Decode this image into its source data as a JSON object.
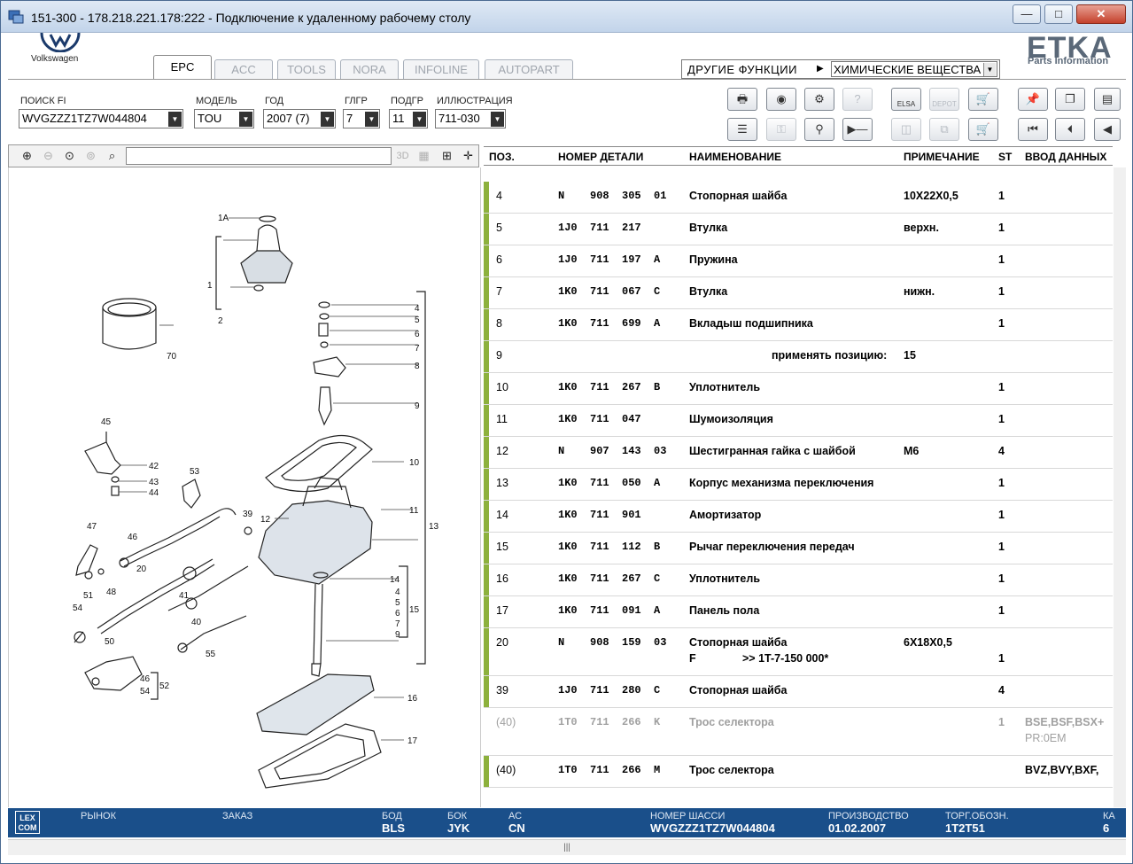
{
  "window": {
    "title": "151-300 - 178.218.221.178:222 - Подключение к удаленному рабочему столу",
    "min": "—",
    "max": "□",
    "close": "✕"
  },
  "brand": {
    "vw": "Volkswagen",
    "etka": "ETKA",
    "etka_sub": "Parts Information"
  },
  "tabs": [
    {
      "label": "EPC"
    },
    {
      "label": "ACC"
    },
    {
      "label": "TOOLS"
    },
    {
      "label": "NORA"
    },
    {
      "label": "INFOLINE"
    },
    {
      "label": "AUTOPART"
    }
  ],
  "other_functions": {
    "label": "ДРУГИЕ ФУНКЦИИ",
    "value": "ХИМИЧЕСКИЕ ВЕЩЕСТВА"
  },
  "filters": {
    "search_fi": {
      "label": "ПОИСК FI",
      "value": "WVGZZZ1TZ7W044804"
    },
    "model": {
      "label": "МОДЕЛЬ",
      "value": "TOU"
    },
    "year": {
      "label": "ГОД",
      "value": "2007 (7)"
    },
    "main_group": {
      "label": "ГЛГР",
      "value": "7"
    },
    "sub_group": {
      "label": "ПОДГР",
      "value": "11"
    },
    "illustration": {
      "label": "ИЛЛЮСТРАЦИЯ",
      "value": "711-030"
    }
  },
  "toolbar": {
    "elsa": "ELSA",
    "depot": "DEPOT"
  },
  "grid": {
    "headers": {
      "pos": "ПОЗ.",
      "part_no": "НОМЕР ДЕТАЛИ",
      "name": "НАИМЕНОВАНИЕ",
      "note": "ПРИМЕЧАНИЕ",
      "st": "ST",
      "data": "ВВОД ДАННЫХ"
    },
    "rows": [
      {
        "pos": "4",
        "p1": "N",
        "p2": "908",
        "p3": "305",
        "p4": "01",
        "name": "Стопорная шайба",
        "note": "10X22X0,5",
        "st": "1",
        "data": ""
      },
      {
        "pos": "5",
        "p1": "1J0",
        "p2": "711",
        "p3": "217",
        "p4": "",
        "name": "Втулка",
        "note": "верхн.",
        "st": "1",
        "data": ""
      },
      {
        "pos": "6",
        "p1": "1J0",
        "p2": "711",
        "p3": "197",
        "p4": "A",
        "name": "Пружина",
        "note": "",
        "st": "1",
        "data": ""
      },
      {
        "pos": "7",
        "p1": "1K0",
        "p2": "711",
        "p3": "067",
        "p4": "C",
        "name": "Втулка",
        "note": "нижн.",
        "st": "1",
        "data": ""
      },
      {
        "pos": "8",
        "p1": "1K0",
        "p2": "711",
        "p3": "699",
        "p4": "A",
        "name": "Вкладыш подшипника",
        "note": "",
        "st": "1",
        "data": ""
      },
      {
        "pos": "9",
        "p1": "",
        "p2": "",
        "p3": "",
        "p4": "",
        "name": "применять позицию:",
        "note": "15",
        "st": "",
        "data": ""
      },
      {
        "pos": "10",
        "p1": "1K0",
        "p2": "711",
        "p3": "267",
        "p4": "B",
        "name": "Уплотнитель",
        "note": "",
        "st": "1",
        "data": ""
      },
      {
        "pos": "11",
        "p1": "1K0",
        "p2": "711",
        "p3": "047",
        "p4": "",
        "name": "Шумоизоляция",
        "note": "",
        "st": "1",
        "data": ""
      },
      {
        "pos": "12",
        "p1": "N",
        "p2": "907",
        "p3": "143",
        "p4": "03",
        "name": "Шестигранная гайка с шайбой",
        "note": "M6",
        "st": "4",
        "data": ""
      },
      {
        "pos": "13",
        "p1": "1K0",
        "p2": "711",
        "p3": "050",
        "p4": "A",
        "name": "Корпус механизма переключения",
        "note": "",
        "st": "1",
        "data": ""
      },
      {
        "pos": "14",
        "p1": "1K0",
        "p2": "711",
        "p3": "901",
        "p4": "",
        "name": "Амортизатор",
        "note": "",
        "st": "1",
        "data": ""
      },
      {
        "pos": "15",
        "p1": "1K0",
        "p2": "711",
        "p3": "112",
        "p4": "B",
        "name": "Рычаг переключения передач",
        "note": "",
        "st": "1",
        "data": ""
      },
      {
        "pos": "16",
        "p1": "1K0",
        "p2": "711",
        "p3": "267",
        "p4": "C",
        "name": "Уплотнитель",
        "note": "",
        "st": "1",
        "data": ""
      },
      {
        "pos": "17",
        "p1": "1K0",
        "p2": "711",
        "p3": "091",
        "p4": "A",
        "name": "Панель пола",
        "note": "",
        "st": "1",
        "data": ""
      },
      {
        "pos": "20",
        "p1": "N",
        "p2": "908",
        "p3": "159",
        "p4": "03",
        "name": "Стопорная шайба",
        "note": "6X18X0,5",
        "st": "1",
        "data": "",
        "line2a": "F",
        "line2b": ">> 1T-7-150 000*"
      },
      {
        "pos": "39",
        "p1": "1J0",
        "p2": "711",
        "p3": "280",
        "p4": "C",
        "name": "Стопорная шайба",
        "note": "",
        "st": "4",
        "data": ""
      },
      {
        "pos": "(40)",
        "p1": "1T0",
        "p2": "711",
        "p3": "266",
        "p4": "K",
        "name": "Трос селектора",
        "note": "",
        "st": "1",
        "data": "BSE,BSF,BSX+",
        "data2": "PR:0EM"
      },
      {
        "pos": "(40)",
        "p1": "1T0",
        "p2": "711",
        "p3": "266",
        "p4": "M",
        "name": "Трос селектора",
        "note": "",
        "st": "",
        "data": "BVZ,BVY,BXF,"
      }
    ]
  },
  "status": {
    "market_label": "РЫНОК",
    "market": "",
    "order_label": "ЗАКАЗ",
    "order": "",
    "engine_label": "БОД",
    "engine": "BLS",
    "gearbox_label": "БОК",
    "gearbox": "JYK",
    "ac_label": "АС",
    "ac": "CN",
    "chassis_label": "НОМЕР ШАССИ",
    "chassis": "WVGZZZ1TZ7W044804",
    "production_label": "ПРОИЗВОДСТВО",
    "production": "01.02.2007",
    "trade_label": "ТОРГ.ОБОЗН.",
    "trade": "1T2T51",
    "extra_label": "КА",
    "extra": "6"
  },
  "illustration_labels": [
    "1A",
    "1",
    "2",
    "70",
    "4",
    "5",
    "6",
    "7",
    "8",
    "9",
    "10",
    "11",
    "13",
    "12",
    "39",
    "45",
    "42",
    "43",
    "44",
    "53",
    "47",
    "46",
    "20",
    "51",
    "48",
    "41",
    "40",
    "54",
    "50",
    "55",
    "46",
    "54",
    "52",
    "14",
    "4",
    "5",
    "6",
    "7",
    "9",
    "15",
    "16",
    "17"
  ],
  "colors": {
    "accent_bar": "#8db13d",
    "status_bg": "#1a4f8a"
  }
}
